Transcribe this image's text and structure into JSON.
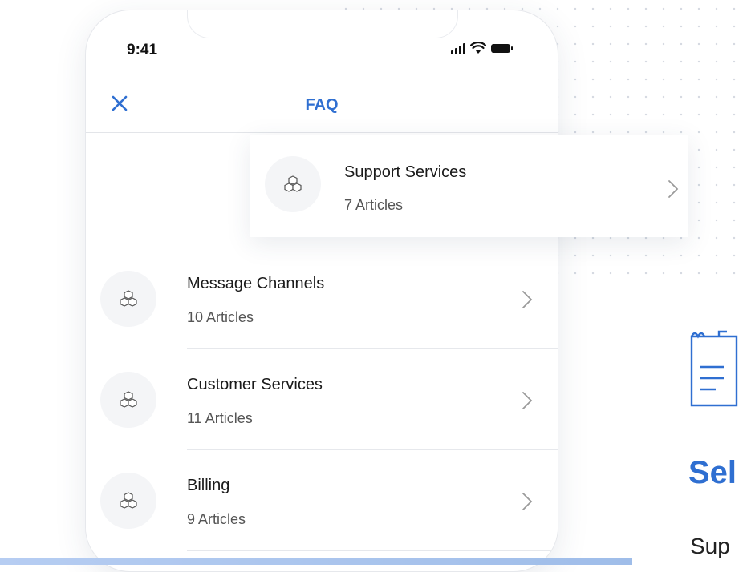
{
  "status_bar": {
    "time": "9:41"
  },
  "nav": {
    "title": "FAQ"
  },
  "featured_item": {
    "title": "Support Services",
    "subtitle": "7 Articles"
  },
  "items": [
    {
      "title": "Message Channels",
      "subtitle": "10 Articles"
    },
    {
      "title": "Customer Services",
      "subtitle": "11 Articles"
    },
    {
      "title": "Billing",
      "subtitle": "9 Articles"
    }
  ],
  "side_panel": {
    "heading": "Sel",
    "text": "Sup"
  },
  "colors": {
    "accent": "#2f6fd1",
    "bottom_bar": "#b6cdf2"
  },
  "icons": {
    "close": "close-icon",
    "item": "cubes-icon",
    "chevron": "chevron-right-icon",
    "document": "document-icon"
  }
}
